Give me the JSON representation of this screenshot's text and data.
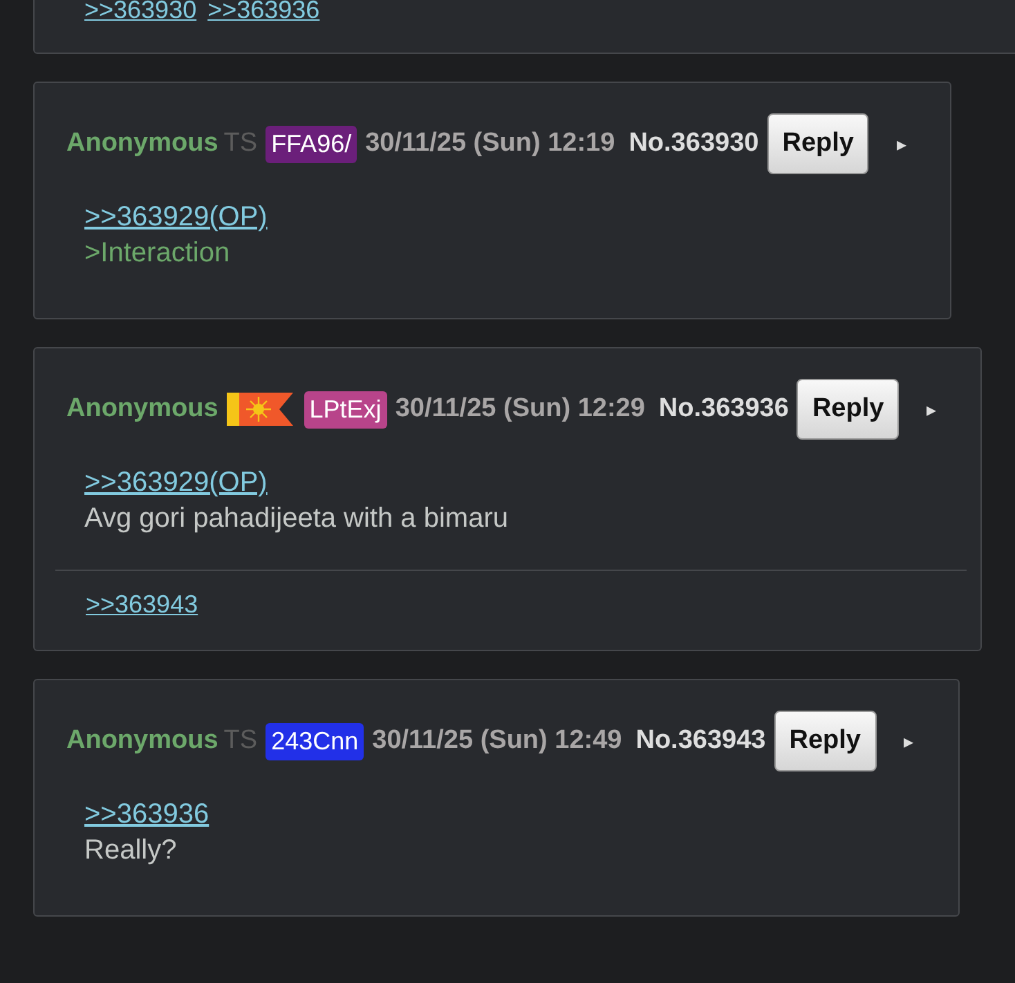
{
  "top_post": {
    "backlinks": [
      ">>363930",
      ">>363936"
    ]
  },
  "posts": [
    {
      "name": "Anonymous",
      "marker": {
        "kind": "text",
        "text": "TS"
      },
      "poster_id": "FFA96/",
      "color": "#6b1f7a",
      "date": "30/11/25 (Sun) 12:19",
      "number": "No.363930",
      "reply": "Reply",
      "menu": "▸",
      "lines": [
        {
          "kind": "quotelink",
          "text": ">>363929(OP)"
        },
        {
          "kind": "greentext",
          "text": ">Interaction"
        }
      ]
    },
    {
      "name": "Anonymous",
      "marker": {
        "kind": "flag"
      },
      "poster_id": "LPtExj",
      "color": "#b8448a",
      "date": "30/11/25 (Sun) 12:29",
      "number": "No.363936",
      "reply": "Reply",
      "menu": "▸",
      "lines": [
        {
          "kind": "quotelink",
          "text": ">>363929(OP)"
        },
        {
          "kind": "text",
          "text": "Avg gori pahadijeeta with a bimaru"
        }
      ],
      "backlinks": [
        ">>363943"
      ]
    },
    {
      "name": "Anonymous",
      "marker": {
        "kind": "text",
        "text": "TS"
      },
      "poster_id": "243Cnn",
      "color": "#2230e8",
      "date": "30/11/25 (Sun) 12:49",
      "number": "No.363943",
      "reply": "Reply",
      "menu": "▸",
      "lines": [
        {
          "kind": "quotelink",
          "text": ">>363936"
        },
        {
          "kind": "text",
          "text": "Really?"
        }
      ]
    }
  ]
}
